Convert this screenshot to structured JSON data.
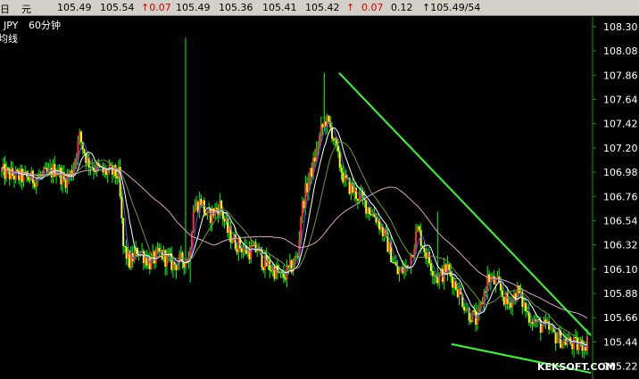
{
  "quote_bar": {
    "label_day": "日",
    "label_yuan": "元",
    "v1": "105.49",
    "v2": "105.54",
    "change1": "↑0.07",
    "v3": "105.49",
    "v4": "105.36",
    "v5": "105.41",
    "v6": "105.42",
    "arrow": "↑",
    "change2": "0.07",
    "v7": "0.12",
    "v8": "↑105.49/54"
  },
  "chart_header": {
    "symbol": "JPY",
    "period": "60分钟",
    "indicator": "均线"
  },
  "watermark": "KEKSOFT.COM",
  "colors": {
    "up_candle": "#ff3030",
    "down_candle": "#ffff00",
    "wick": "#00ff00",
    "trendline": "#32ff32",
    "ma_white": "#ffffff",
    "ma_blue": "#5050ff",
    "ma_green": "#6e9a2a",
    "ma_pink": "#e0a0c0",
    "axis_line": "#00a000"
  },
  "chart_data": {
    "type": "candlestick",
    "title": "",
    "ylim": [
      105.12,
      108.38
    ],
    "y_ticks": [
      "108.30",
      "108.08",
      "107.86",
      "107.64",
      "107.42",
      "107.20",
      "106.98",
      "106.76",
      "106.54",
      "106.32",
      "106.10",
      "105.88",
      "105.66",
      "105.44",
      "105.22"
    ],
    "y_tick_values": [
      108.3,
      108.08,
      107.86,
      107.64,
      107.42,
      107.2,
      106.98,
      106.76,
      106.54,
      106.32,
      106.1,
      105.88,
      105.66,
      105.44,
      105.22
    ],
    "num_bars": 220,
    "price_keypoints": [
      [
        0,
        106.98
      ],
      [
        10,
        106.94
      ],
      [
        20,
        106.92
      ],
      [
        30,
        106.96
      ],
      [
        35,
        107.02
      ],
      [
        40,
        106.9
      ],
      [
        45,
        106.98
      ],
      [
        50,
        107.3
      ],
      [
        55,
        107.08
      ],
      [
        60,
        107.02
      ],
      [
        65,
        106.98
      ],
      [
        70,
        106.98
      ],
      [
        75,
        106.95
      ],
      [
        78,
        106.3
      ],
      [
        82,
        106.16
      ],
      [
        88,
        106.28
      ],
      [
        95,
        106.16
      ],
      [
        102,
        106.24
      ],
      [
        110,
        106.14
      ],
      [
        116,
        106.18
      ],
      [
        120,
        106.2
      ],
      [
        123,
        106.65
      ],
      [
        128,
        106.72
      ],
      [
        132,
        106.56
      ],
      [
        140,
        106.68
      ],
      [
        145,
        106.44
      ],
      [
        150,
        106.34
      ],
      [
        158,
        106.26
      ],
      [
        164,
        106.28
      ],
      [
        168,
        106.16
      ],
      [
        172,
        106.12
      ],
      [
        176,
        106.08
      ],
      [
        180,
        106.02
      ],
      [
        185,
        106.1
      ],
      [
        190,
        106.22
      ],
      [
        192,
        106.6
      ],
      [
        195,
        106.8
      ],
      [
        200,
        107.05
      ],
      [
        205,
        107.35
      ],
      [
        208,
        107.45
      ],
      [
        212,
        107.35
      ],
      [
        216,
        107.1
      ],
      [
        220,
        106.9
      ]
    ],
    "segment2_keypoints": [
      [
        0,
        106.9
      ],
      [
        12,
        106.7
      ],
      [
        20,
        106.55
      ],
      [
        26,
        106.32
      ],
      [
        32,
        106.06
      ],
      [
        38,
        106.12
      ],
      [
        44,
        106.46
      ],
      [
        50,
        106.2
      ],
      [
        56,
        106.02
      ],
      [
        62,
        106.1
      ],
      [
        68,
        105.92
      ],
      [
        74,
        105.72
      ],
      [
        80,
        105.62
      ],
      [
        86,
        106.02
      ],
      [
        92,
        105.96
      ],
      [
        98,
        105.78
      ],
      [
        104,
        105.9
      ],
      [
        110,
        105.7
      ],
      [
        116,
        105.6
      ],
      [
        122,
        105.56
      ],
      [
        128,
        105.48
      ],
      [
        134,
        105.44
      ],
      [
        140,
        105.4
      ],
      [
        146,
        105.44
      ]
    ],
    "spike_bars": [
      {
        "segment": 1,
        "index": 118,
        "high": 108.2
      },
      {
        "segment": 1,
        "index": 121,
        "low": 105.98
      },
      {
        "segment": 1,
        "index": 207,
        "high": 107.88
      },
      {
        "segment": 2,
        "index": 56,
        "high": 106.62
      }
    ],
    "moving_averages": [
      {
        "color_key": "ma_blue",
        "period": 5
      },
      {
        "color_key": "ma_white",
        "period": 10
      },
      {
        "color_key": "ma_green",
        "period": 20
      },
      {
        "color_key": "ma_pink",
        "period": 60
      }
    ],
    "trendlines": [
      {
        "from": [
          380,
          107.88
        ],
        "to": [
          662,
          105.5
        ]
      },
      {
        "from": [
          506,
          105.42
        ],
        "to": [
          662,
          105.16
        ]
      }
    ],
    "grid": false,
    "legend": "none"
  }
}
